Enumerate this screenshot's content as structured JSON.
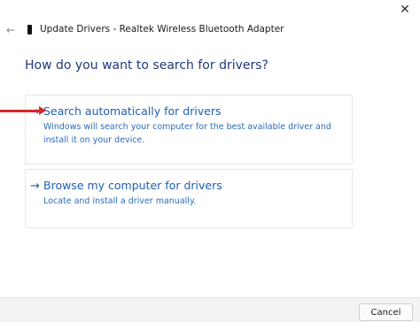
{
  "window": {
    "title": "Update Drivers - Realtek Wireless Bluetooth Adapter",
    "close_glyph": "✕",
    "back_glyph": "←"
  },
  "main": {
    "heading": "How do you want to search for drivers?",
    "options": [
      {
        "arrow": "→",
        "title": "Search automatically for drivers",
        "description": "Windows will search your computer for the best available driver and install it on your device."
      },
      {
        "arrow": "→",
        "title": "Browse my computer for drivers",
        "description": "Locate and install a driver manually."
      }
    ]
  },
  "footer": {
    "cancel_label": "Cancel"
  },
  "colors": {
    "accent": "#1f5fb3",
    "heading": "#1f3a7a",
    "annotation": "#d62828"
  }
}
